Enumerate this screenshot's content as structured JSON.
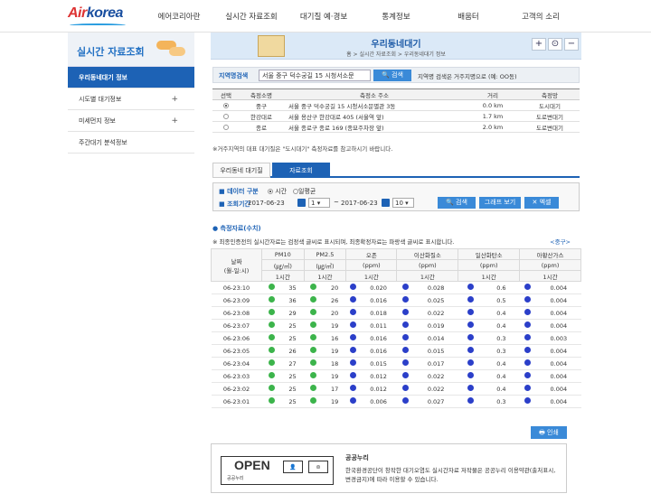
{
  "header": {
    "logo_air": "Air",
    "logo_korea": "korea",
    "nav": [
      "에어코리아란",
      "실시간 자료조회",
      "대기질 예·경보",
      "통계정보",
      "배움터",
      "고객의 소리"
    ]
  },
  "sidebar": {
    "title": "실시간 자료조회",
    "items": [
      {
        "label": "우리동네대기 정보",
        "plus": ""
      },
      {
        "label": "시도별 대기정보",
        "plus": "+"
      },
      {
        "label": "미세먼지 정보",
        "plus": "+"
      },
      {
        "label": "주간대기 분석정보",
        "plus": ""
      }
    ]
  },
  "page": {
    "title": "우리동네대기",
    "breadcrumb": "홈 > 실시간 자료조회 > 우리동네대기 정보",
    "zoom_in": "+",
    "zoom_reset": "⊙",
    "zoom_out": "−"
  },
  "search": {
    "label": "지역명검색",
    "value": "서울 중구 덕수궁길 15 시청서소문",
    "button": "검색",
    "hint": "지역명 검색은 거주지명으로 (예: OO동)"
  },
  "stations": {
    "headers": [
      "선택",
      "측정소명",
      "측정소 주소",
      "거리",
      "측정망"
    ],
    "rows": [
      {
        "selected": true,
        "name": "중구",
        "addr": "서울 중구 덕수궁길 15 시청서소문별관 3동",
        "dist": "0.0 km",
        "net": "도시대기"
      },
      {
        "selected": false,
        "name": "한강대로",
        "addr": "서울 용산구 한강대로 405 (서울역 앞)",
        "dist": "1.7 km",
        "net": "도로변대기"
      },
      {
        "selected": false,
        "name": "종로",
        "addr": "서울 종로구 종로 169 (종묘주차장 앞)",
        "dist": "2.0 km",
        "net": "도로변대기"
      }
    ],
    "note": "※거주지역의 대표 대기질은 \"도시대기\" 측정자료를 참고하시기 바랍니다."
  },
  "tabs": [
    "우리동네 대기질",
    "자료조회"
  ],
  "filter": {
    "type_label": "데이터 구분",
    "opt_hour": "시간",
    "opt_day": "일평균",
    "period_label": "조회기간",
    "date_from": "2017-06-23",
    "hour_from": "1",
    "tilde": "~",
    "date_to": "2017-06-23",
    "hour_to": "10",
    "btn_search": "검색",
    "btn_graph": "그래프 보기",
    "btn_excel": "엑셀"
  },
  "data_section": {
    "title": "측정자료(수치)",
    "desc": "※ 최종인증전의 실시간자료는 검정색 글씨로 표시되며, 최종확정자료는 파랑색 글씨로 표시합니다.",
    "station_tag": "<중구>",
    "headers": {
      "date": "날짜",
      "date_sub": "(월-일:시)",
      "pm10": "PM10",
      "pm25": "PM2.5",
      "pm_unit": "(㎍/㎥)",
      "o3": "오존",
      "no2": "이산화질소",
      "co": "일산화탄소",
      "so2": "아황산가스",
      "ppm": "(ppm)",
      "hour1": "1시간"
    },
    "rows": [
      [
        "06-23:10",
        "35",
        "20",
        "0.020",
        "0.028",
        "0.6",
        "0.004"
      ],
      [
        "06-23:09",
        "36",
        "26",
        "0.016",
        "0.025",
        "0.5",
        "0.004"
      ],
      [
        "06-23:08",
        "29",
        "20",
        "0.018",
        "0.022",
        "0.4",
        "0.004"
      ],
      [
        "06-23:07",
        "25",
        "19",
        "0.011",
        "0.019",
        "0.4",
        "0.004"
      ],
      [
        "06-23:06",
        "25",
        "16",
        "0.016",
        "0.014",
        "0.3",
        "0.003"
      ],
      [
        "06-23:05",
        "26",
        "19",
        "0.016",
        "0.015",
        "0.3",
        "0.004"
      ],
      [
        "06-23:04",
        "27",
        "18",
        "0.015",
        "0.017",
        "0.4",
        "0.004"
      ],
      [
        "06-23:03",
        "25",
        "19",
        "0.012",
        "0.022",
        "0.4",
        "0.004"
      ],
      [
        "06-23:02",
        "25",
        "17",
        "0.012",
        "0.022",
        "0.4",
        "0.004"
      ],
      [
        "06-23:01",
        "25",
        "19",
        "0.006",
        "0.027",
        "0.3",
        "0.004"
      ]
    ],
    "dot_colors": {
      "good": "#3cb44b",
      "normal": "#2b3fc9"
    }
  },
  "print_button": "인쇄",
  "license": {
    "open": "OPEN",
    "open_sub": "공공누리",
    "title": "공공누리",
    "desc": "한국환경공단이 창작한 대기오염도 실시간자료 저작물은 공공누리 이용약관(출처표시, 변경금지)에 따라 이용할 수 있습니다."
  }
}
